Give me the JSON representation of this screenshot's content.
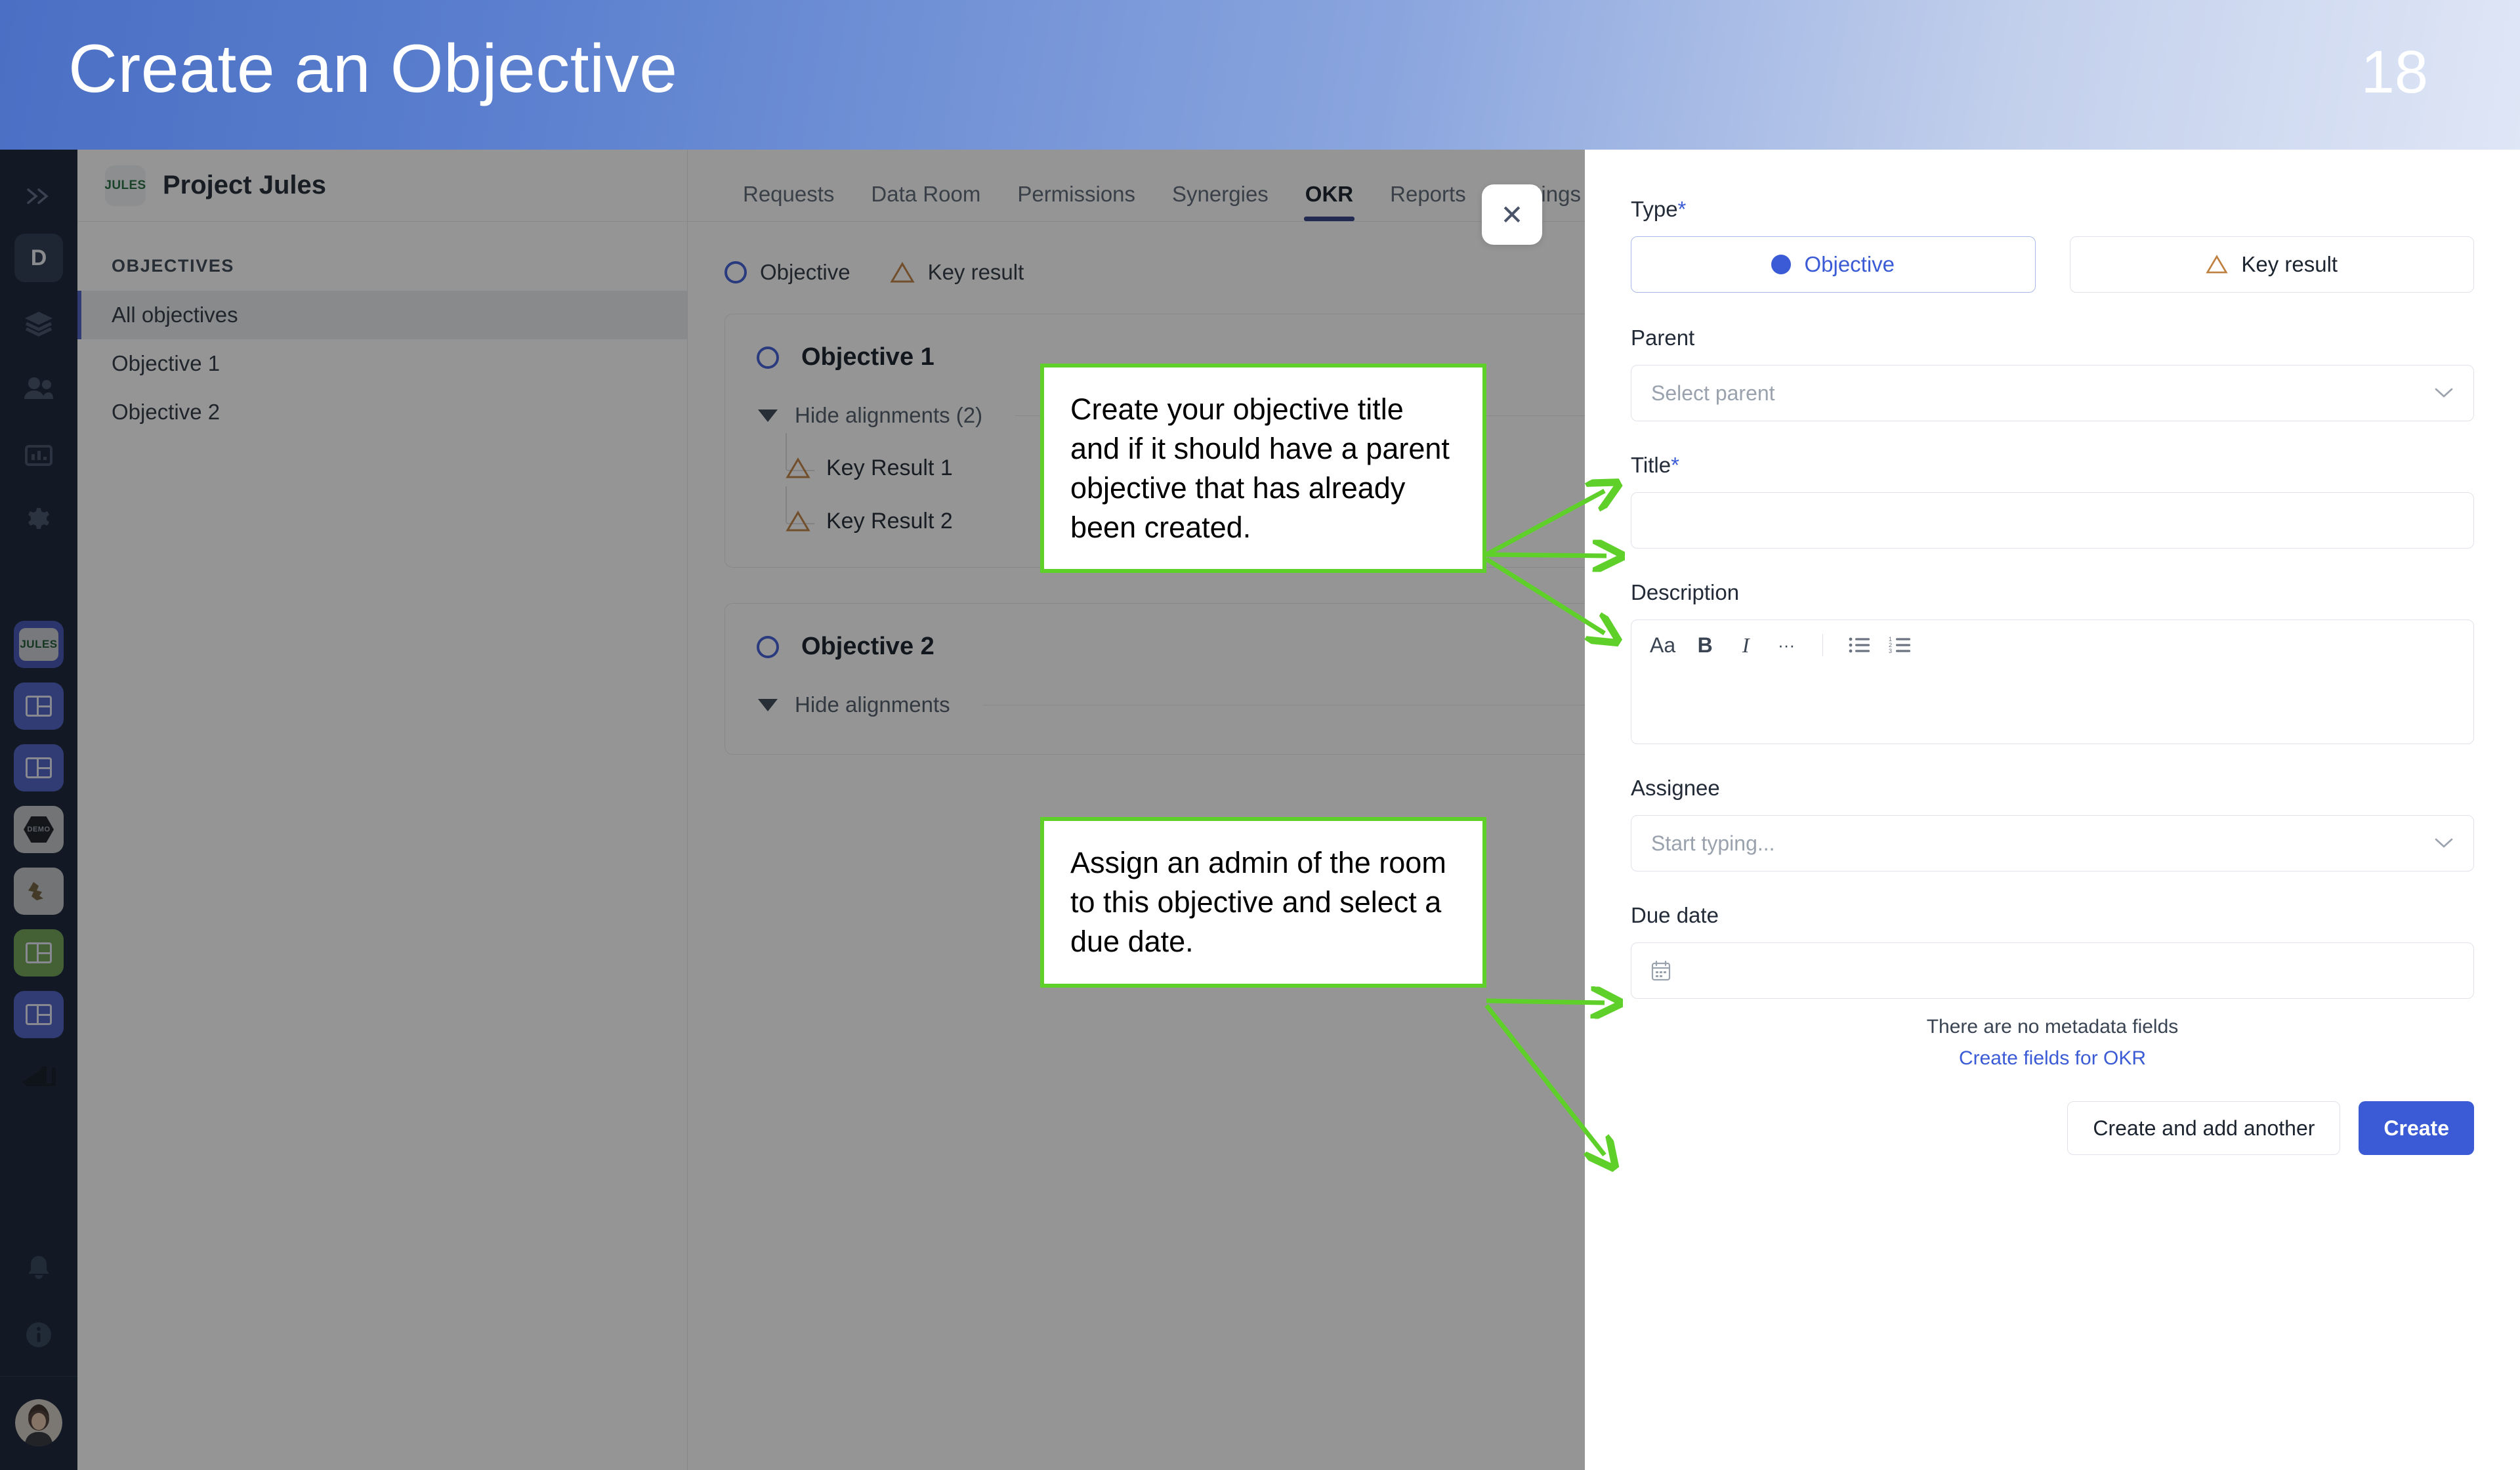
{
  "slide": {
    "title": "Create an Objective",
    "number": "18"
  },
  "rail": {
    "collapse_label": "»",
    "avatar_initial": "D",
    "items": [
      {
        "name": "expand-rail",
        "label": "»"
      },
      {
        "name": "workspace-avatar",
        "label": "D"
      },
      {
        "name": "layers-icon",
        "label": ""
      },
      {
        "name": "people-icon",
        "label": ""
      },
      {
        "name": "analytics-icon",
        "label": ""
      },
      {
        "name": "settings-icon",
        "label": ""
      }
    ],
    "project_tiles": [
      {
        "name": "project-jules",
        "label": "JULES",
        "color": "#3f51b5"
      },
      {
        "name": "project-tile-2",
        "label": "",
        "color": "#4a5ec4"
      },
      {
        "name": "project-tile-3",
        "label": "",
        "color": "#4a5ec4"
      },
      {
        "name": "project-tile-demo",
        "label": "DEMO",
        "color": "#bfc3c7"
      },
      {
        "name": "project-tile-5",
        "label": "",
        "color": "#bfc3c7"
      },
      {
        "name": "project-tile-6",
        "label": "",
        "color": "#6aa04f"
      },
      {
        "name": "project-tile-7",
        "label": "",
        "color": "#4a5ec4"
      },
      {
        "name": "project-tile-8",
        "label": "",
        "color": "#111e33"
      }
    ],
    "bottom": [
      {
        "name": "notifications-bell-icon"
      },
      {
        "name": "info-icon"
      },
      {
        "name": "user-avatar"
      }
    ]
  },
  "sidebar": {
    "brand_badge": "JULES",
    "project_name": "Project Jules",
    "section_label": "OBJECTIVES",
    "items": [
      {
        "label": "All objectives",
        "active": true
      },
      {
        "label": "Objective 1",
        "active": false
      },
      {
        "label": "Objective 2",
        "active": false
      }
    ]
  },
  "topnav": {
    "tabs": [
      {
        "label": "Requests",
        "active": false
      },
      {
        "label": "Data Room",
        "active": false
      },
      {
        "label": "Permissions",
        "active": false
      },
      {
        "label": "Synergies",
        "active": false
      },
      {
        "label": "OKR",
        "active": true
      },
      {
        "label": "Reports",
        "active": false
      },
      {
        "label": "Settings",
        "active": false
      }
    ]
  },
  "main": {
    "legend": [
      {
        "icon": "circle",
        "label": "Objective"
      },
      {
        "icon": "triangle",
        "label": "Key result"
      }
    ],
    "objectives": [
      {
        "title": "Objective 1",
        "alignments_label": "Hide alignments (2)",
        "key_results": [
          "Key Result 1",
          "Key Result 2"
        ]
      },
      {
        "title": "Objective 2",
        "alignments_label": "Hide alignments",
        "key_results": []
      }
    ]
  },
  "drawer": {
    "close_label": "✕",
    "type": {
      "label": "Type",
      "required": "*",
      "options": [
        {
          "label": "Objective",
          "selected": true
        },
        {
          "label": "Key result",
          "selected": false
        }
      ]
    },
    "parent": {
      "label": "Parent",
      "placeholder": "Select parent",
      "value": ""
    },
    "title": {
      "label": "Title",
      "required": "*",
      "placeholder": "",
      "value": ""
    },
    "description": {
      "label": "Description",
      "toolbar": [
        {
          "name": "font-size-icon",
          "glyph": "Aa"
        },
        {
          "name": "bold-icon",
          "glyph": "B"
        },
        {
          "name": "italic-icon",
          "glyph": "I"
        },
        {
          "name": "more-formats-icon",
          "glyph": "···"
        },
        {
          "name": "bulleted-list-icon",
          "glyph": ""
        },
        {
          "name": "numbered-list-icon",
          "glyph": ""
        }
      ],
      "value": ""
    },
    "assignee": {
      "label": "Assignee",
      "placeholder": "Start typing...",
      "value": ""
    },
    "due_date": {
      "label": "Due date",
      "placeholder": "",
      "value": ""
    },
    "metadata_note": "There are no metadata fields",
    "metadata_link": "Create fields for OKR",
    "buttons": {
      "secondary": "Create and add another",
      "primary": "Create"
    }
  },
  "annotations": [
    {
      "name": "callout-title-parent",
      "text": "Create your objective title and if it should have a parent objective that has already been created."
    },
    {
      "name": "callout-assignee-due",
      "text": "Assign an admin of the room to this objective and select a due date."
    }
  ],
  "colors": {
    "accent_blue": "#3b5bd6",
    "annotation_green": "#5fd02a",
    "rail_dark": "#111e33",
    "keyresult_orange": "#c08040",
    "header_gradient_start": "#4a6fc4",
    "header_gradient_end": "#dfe6f6"
  }
}
